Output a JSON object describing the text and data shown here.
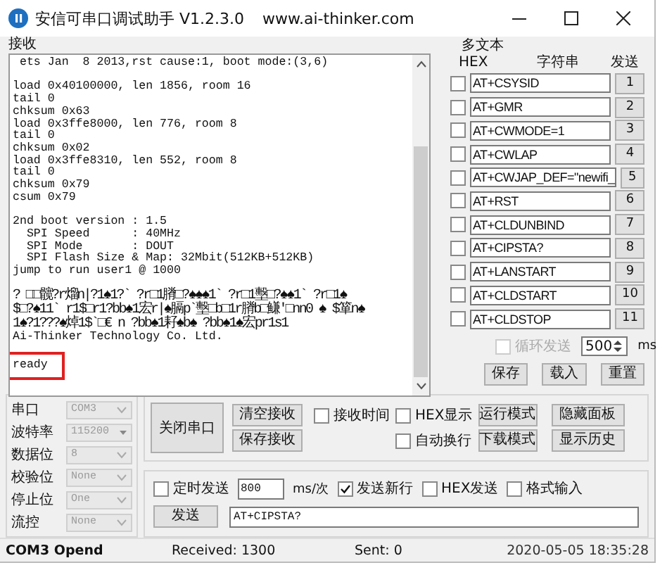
{
  "window": {
    "title": "安信可串口调试助手 V1.2.3.0",
    "url": "www.ai-thinker.com"
  },
  "receive": {
    "label": "接收",
    "blocks": [
      {
        "highlighted": false,
        "lines": [
          {
            "kind": "ascii",
            "text": " ets Jan  8 2013,rst cause:1, boot mode:(3,6)"
          }
        ]
      },
      {
        "highlighted": false,
        "lines": [
          {
            "kind": "ascii",
            "text": "load 0x40100000, len 1856, room 16"
          },
          {
            "kind": "ascii",
            "text": "tail 0"
          },
          {
            "kind": "ascii",
            "text": "chksum 0x63"
          },
          {
            "kind": "ascii",
            "text": "load 0x3ffe8000, len 776, room 8"
          },
          {
            "kind": "ascii",
            "text": "tail 0"
          },
          {
            "kind": "ascii",
            "text": "chksum 0x02"
          },
          {
            "kind": "ascii",
            "text": "load 0x3ffe8310, len 552, room 8"
          },
          {
            "kind": "ascii",
            "text": "tail 0"
          },
          {
            "kind": "ascii",
            "text": "chksum 0x79"
          },
          {
            "kind": "ascii",
            "text": "csum 0x79"
          }
        ]
      },
      {
        "highlighted": false,
        "lines": [
          {
            "kind": "ascii",
            "text": "2nd boot version : 1.5"
          },
          {
            "kind": "ascii",
            "text": "  SPI Speed      : 40MHz"
          },
          {
            "kind": "ascii",
            "text": "  SPI Mode       : DOUT"
          },
          {
            "kind": "ascii",
            "text": "  SPI Flash Size & Map: 32Mbit(512KB+512KB)"
          },
          {
            "kind": "ascii",
            "text": "jump to run user1 @ 1000"
          }
        ]
      },
      {
        "highlighted": false,
        "lines": [
          {
            "kind": "garbled",
            "text": "? □□髋?r熘n|?1♠1?` ?r□1膌□?♠♠♠1` ?r□1墼□?♠♠1` ?r□1♠"
          },
          {
            "kind": "garbled",
            "text": "$□?♠11` r1$□r1?bb♠1宏r|♠膈p`墼□b□1r膌b□鳒'□nn0 ♠ $箪n♠"
          },
          {
            "kind": "garbled",
            "text": "1♠?1???♠焯1$`□€ n ?bb♠1耔♠b♠ ?bb♠1♠宏pr1s1"
          },
          {
            "kind": "ascii",
            "text": "Ai-Thinker Technology Co. Ltd."
          }
        ]
      },
      {
        "highlighted": true,
        "lines": [
          {
            "kind": "ascii",
            "text": "ready"
          }
        ]
      }
    ]
  },
  "multi_text": {
    "title": "多文本",
    "headers": [
      "HEX",
      "字符串",
      "发送"
    ],
    "rows": [
      {
        "hex": false,
        "command": "AT+CSYSID",
        "button": "1"
      },
      {
        "hex": false,
        "command": "AT+GMR",
        "button": "2"
      },
      {
        "hex": false,
        "command": "AT+CWMODE=1",
        "button": "3"
      },
      {
        "hex": false,
        "command": "AT+CWLAP",
        "button": "4"
      },
      {
        "hex": false,
        "command": "AT+CWJAP_DEF=\"newifi_",
        "button": "5"
      },
      {
        "hex": false,
        "command": "AT+RST",
        "button": "6"
      },
      {
        "hex": false,
        "command": "AT+CLDUNBIND",
        "button": "7"
      },
      {
        "hex": false,
        "command": "AT+CIPSTA?",
        "button": "8"
      },
      {
        "hex": false,
        "command": "AT+LANSTART",
        "button": "9"
      },
      {
        "hex": false,
        "command": "AT+CLDSTART",
        "button": "10"
      },
      {
        "hex": false,
        "command": "AT+CLDSTOP",
        "button": "11"
      }
    ],
    "loop": {
      "label": "循环发送",
      "checked": false,
      "disabled": true,
      "interval": "500",
      "unit": "ms"
    },
    "buttons": [
      "保存",
      "载入",
      "重置"
    ]
  },
  "serial": {
    "fields": [
      {
        "label": "串口",
        "value": "COM3",
        "kind": "dropdown"
      },
      {
        "label": "波特率",
        "value": "115200",
        "kind": "combo"
      },
      {
        "label": "数据位",
        "value": "8",
        "kind": "dropdown"
      },
      {
        "label": "校验位",
        "value": "None",
        "kind": "dropdown"
      },
      {
        "label": "停止位",
        "value": "One",
        "kind": "dropdown"
      },
      {
        "label": "流控",
        "value": "None",
        "kind": "dropdown"
      }
    ]
  },
  "controls": {
    "port_button": "关闭串口",
    "clear_button": "清空接收",
    "save_button": "保存接收",
    "options": [
      {
        "label": "接收时间",
        "checked": false
      },
      {
        "label": "HEX显示",
        "checked": false
      },
      {
        "label": "自动换行",
        "checked": false
      }
    ],
    "mode_buttons": [
      "运行模式",
      "下载模式"
    ],
    "panel_buttons": [
      "隐藏面板",
      "显示历史"
    ]
  },
  "send": {
    "timed": {
      "label": "定时发送",
      "checked": false
    },
    "interval": "800",
    "unit": "ms/次",
    "options": [
      {
        "label": "发送新行",
        "checked": true
      },
      {
        "label": "HEX发送",
        "checked": false
      },
      {
        "label": "格式输入",
        "checked": false
      }
    ],
    "button": "发送",
    "value": "AT+CIPSTA?"
  },
  "status_bar": [
    "COM3 Opend",
    "Received: 1300",
    "Sent: 0",
    "2020-05-05 18:35:28"
  ]
}
